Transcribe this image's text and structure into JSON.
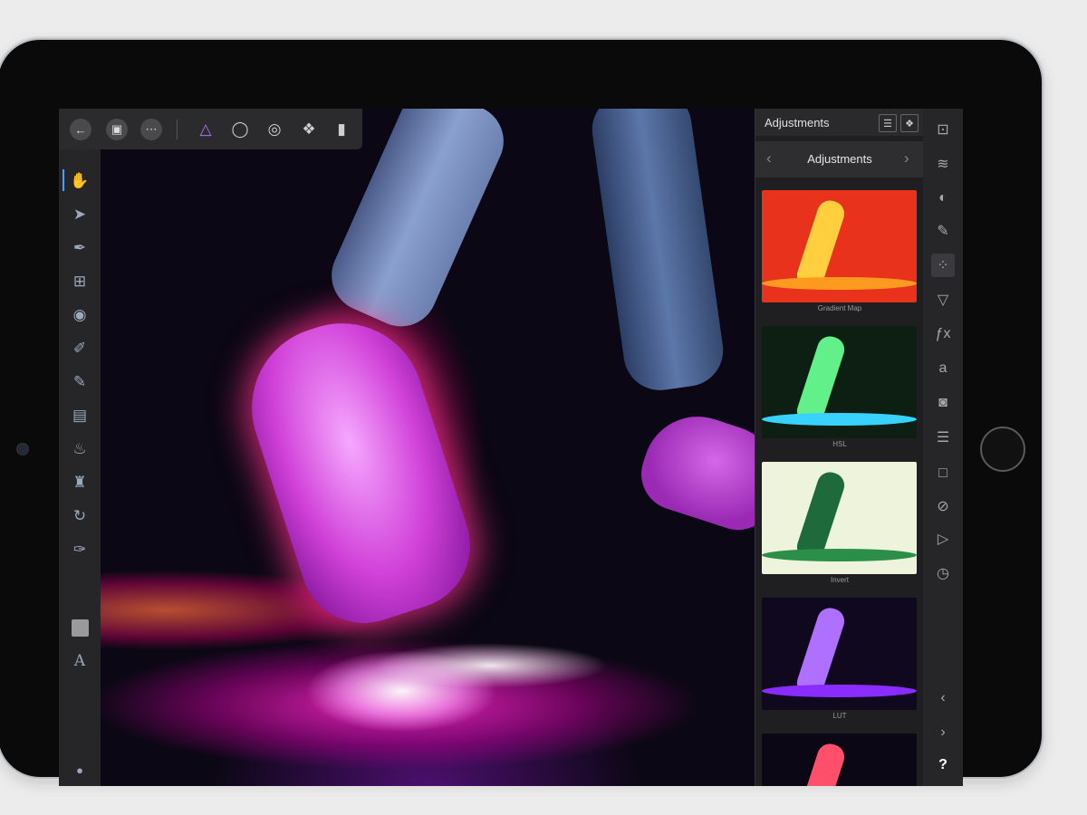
{
  "toolbar": {
    "back_icon": "back-arrow-icon",
    "document_icon": "document-icon",
    "more_icon": "more-icon",
    "persona_photo_icon": "photo-persona-icon",
    "persona_liquify_icon": "liquify-persona-icon",
    "persona_develop_icon": "develop-persona-icon",
    "persona_tonemap_icon": "tone-mapping-persona-icon",
    "persona_export_icon": "export-persona-icon"
  },
  "left_tools": [
    {
      "name": "hand-tool-icon"
    },
    {
      "name": "move-tool-icon"
    },
    {
      "name": "color-picker-tool-icon"
    },
    {
      "name": "crop-tool-icon"
    },
    {
      "name": "fill-tool-icon"
    },
    {
      "name": "selection-brush-tool-icon"
    },
    {
      "name": "paint-brush-tool-icon"
    },
    {
      "name": "eraser-tool-icon"
    },
    {
      "name": "dodge-tool-icon"
    },
    {
      "name": "clone-tool-icon"
    },
    {
      "name": "healing-tool-icon"
    },
    {
      "name": "pen-tool-icon"
    },
    {
      "name": "shape-tool-icon"
    },
    {
      "name": "text-tool-icon"
    },
    {
      "name": "color-drop-icon"
    }
  ],
  "adjustments": {
    "header_title": "Adjustments",
    "nav_title": "Adjustments",
    "items": [
      {
        "label": "Gradient Map",
        "bg": "#e8321c",
        "fig": "#ffcf40",
        "floor": "#ff9a20"
      },
      {
        "label": "HSL",
        "bg": "#0d1e12",
        "fig": "#62f08a",
        "floor": "#38d2ff"
      },
      {
        "label": "Invert",
        "bg": "#eef4dc",
        "fig": "#1f6a3a",
        "floor": "#2b8f4a"
      },
      {
        "label": "LUT",
        "bg": "#10081e",
        "fig": "#b070ff",
        "floor": "#8a2cff"
      },
      {
        "label": "",
        "bg": "#0b0714",
        "fig": "#ff4f6a",
        "floor": "#ff2060"
      }
    ]
  },
  "right_bar": [
    {
      "name": "canvas-icon",
      "glyph": "⊡",
      "active": false
    },
    {
      "name": "layers-icon",
      "glyph": "≋",
      "active": false
    },
    {
      "name": "color-wheel-icon",
      "glyph": "◐",
      "active": false
    },
    {
      "name": "brushes-icon",
      "glyph": "✎",
      "active": false
    },
    {
      "name": "adjustments-icon",
      "glyph": "⁘",
      "active": true
    },
    {
      "name": "filters-icon",
      "glyph": "▽",
      "active": false
    },
    {
      "name": "effects-icon",
      "glyph": "ƒx",
      "active": false
    },
    {
      "name": "text-styles-icon",
      "glyph": "a",
      "active": false
    },
    {
      "name": "camera-icon",
      "glyph": "◙",
      "active": false
    },
    {
      "name": "sliders-icon",
      "glyph": "☰",
      "active": false
    },
    {
      "name": "transform-icon",
      "glyph": "□",
      "active": false
    },
    {
      "name": "no-entry-icon",
      "glyph": "⊘",
      "active": false
    },
    {
      "name": "play-icon",
      "glyph": "▷",
      "active": false
    },
    {
      "name": "history-icon",
      "glyph": "◷",
      "active": false
    },
    {
      "name": "undo-icon",
      "glyph": "‹",
      "active": false
    },
    {
      "name": "redo-icon",
      "glyph": "›",
      "active": false
    },
    {
      "name": "help-icon",
      "glyph": "?",
      "active": false
    }
  ],
  "colors": {
    "accent": "#3aa3ff",
    "panel": "#1f1f21",
    "toolbar": "#2b2b2d"
  }
}
